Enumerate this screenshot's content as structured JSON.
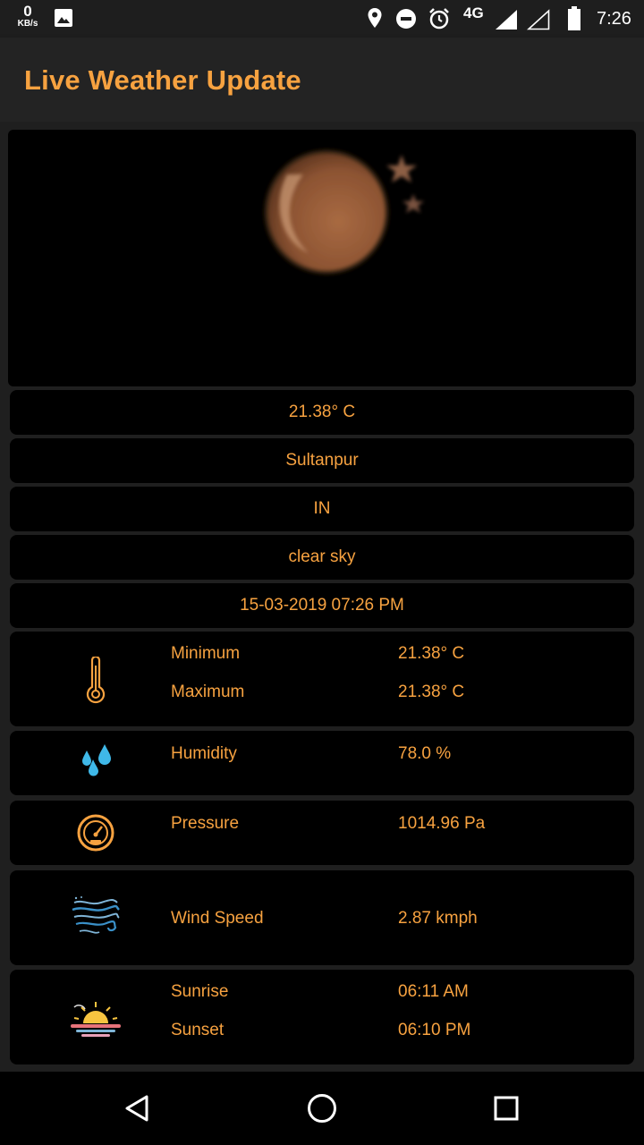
{
  "status_bar": {
    "net_speed_value": "0",
    "net_speed_unit": "KB/s",
    "network_type": "4G",
    "time": "7:26",
    "icons": [
      "image-icon",
      "location-icon",
      "do-not-disturb-icon",
      "alarm-icon",
      "signal-icon",
      "signal-empty-icon",
      "battery-icon"
    ]
  },
  "app_bar": {
    "title": "Live Weather Update"
  },
  "hero": {
    "icon": "moon-stars-icon"
  },
  "summary": {
    "temperature": "21.38° C",
    "city": "Sultanpur",
    "country": "IN",
    "description": "clear sky",
    "datetime": "15-03-2019 07:26 PM"
  },
  "details": {
    "temp_range": {
      "icon": "thermometer-icon",
      "min_label": "Minimum",
      "min_value": "21.38° C",
      "max_label": "Maximum",
      "max_value": "21.38° C"
    },
    "humidity": {
      "icon": "water-drops-icon",
      "label": "Humidity",
      "value": "78.0 %"
    },
    "pressure": {
      "icon": "gauge-icon",
      "label": "Pressure",
      "value": "1014.96 Pa"
    },
    "wind": {
      "icon": "wind-icon",
      "label": "Wind Speed",
      "value": "2.87 kmph"
    },
    "sun": {
      "icon": "sunrise-icon",
      "sunrise_label": "Sunrise",
      "sunrise_value": "06:11 AM",
      "sunset_label": "Sunset",
      "sunset_value": "06:10 PM"
    }
  },
  "nav_bar": {
    "icons": [
      "back-icon",
      "home-icon",
      "recents-icon"
    ]
  },
  "colors": {
    "accent": "#f7a240",
    "card_background": "#000000",
    "page_background": "#1f1f1f",
    "humidity_blue": "#3fb8e8"
  }
}
